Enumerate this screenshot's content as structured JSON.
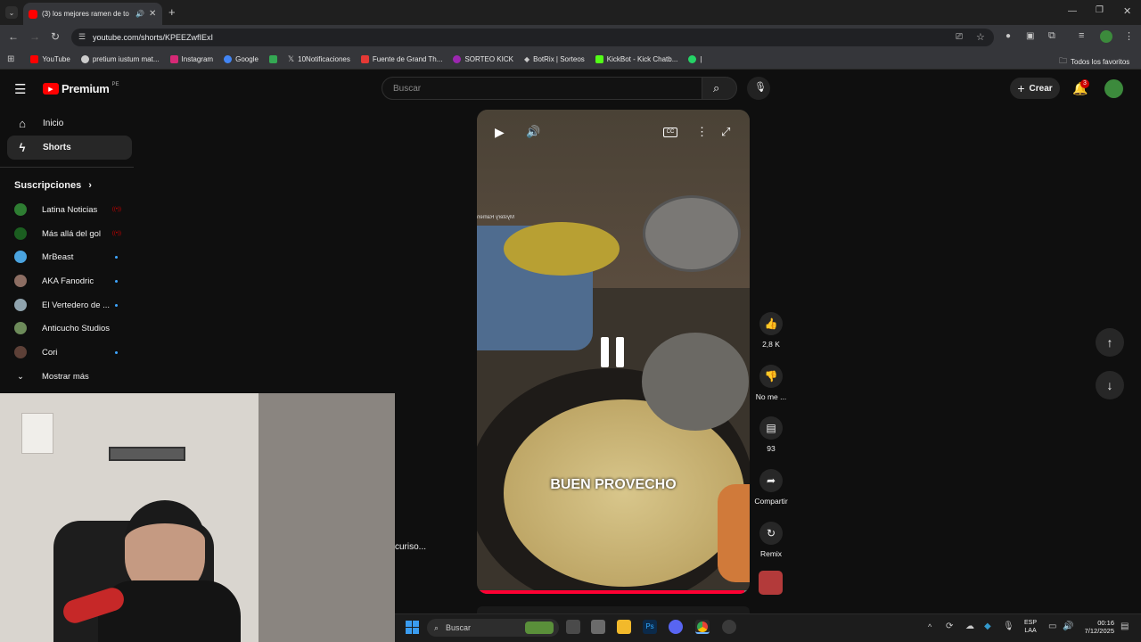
{
  "browser": {
    "tab_title": "(3) los mejores ramen de to",
    "url": "youtube.com/shorts/KPEEZwfIExI",
    "bookmarks": [
      {
        "label": "YouTube",
        "color": "#ff0000"
      },
      {
        "label": "pretium iustum mat...",
        "color": "#cccccc"
      },
      {
        "label": "Instagram",
        "color": "#d62976"
      },
      {
        "label": "Google",
        "color": "#4285f4"
      },
      {
        "label": "",
        "color": "#34a853"
      },
      {
        "label": "10Notificaciones",
        "color": "#e8e8e8"
      },
      {
        "label": "Fuente de Grand Th...",
        "color": "#e53935"
      },
      {
        "label": "SORTEO KICK",
        "color": "#9c27b0"
      },
      {
        "label": "BotRix | Sorteos",
        "color": "#e8e8e8"
      },
      {
        "label": "KickBot - Kick Chatb...",
        "color": "#53fc18"
      },
      {
        "label": "|",
        "color": "#25d366"
      }
    ],
    "all_bookmarks": "Todos los favoritos"
  },
  "youtube": {
    "logo_text": "Premium",
    "region": "PE",
    "search_placeholder": "Buscar",
    "create_label": "Crear",
    "notif_count": "3",
    "nav": [
      {
        "label": "Inicio",
        "icon": "home-icon"
      },
      {
        "label": "Shorts",
        "icon": "shorts-icon"
      }
    ],
    "subs_title": "Suscripciones",
    "subs": [
      {
        "label": "Latina Noticias",
        "color": "#2e7d32",
        "status": "live"
      },
      {
        "label": "Más allá del gol",
        "color": "#1b5e20",
        "status": "live"
      },
      {
        "label": "MrBeast",
        "color": "#4aa3df",
        "status": "dot"
      },
      {
        "label": "AKA Fanodric",
        "color": "#8d6e63",
        "status": "dot"
      },
      {
        "label": "El Vertedero de ...",
        "color": "#90a4ae",
        "status": "dot"
      },
      {
        "label": "Anticucho Studios",
        "color": "#6d8b5a",
        "status": "none"
      },
      {
        "label": "Cori",
        "color": "#5d4037",
        "status": "dot"
      }
    ],
    "show_more": "Mostrar más",
    "video_caption": "BUEN PROVECHO",
    "watermark": "Mystery Ramen",
    "partial_text": "curiso...",
    "actions": {
      "likes": "2,8 K",
      "dislike": "No me ...",
      "comments": "93",
      "share": "Compartir",
      "remix": "Remix"
    }
  },
  "taskbar": {
    "search": "Buscar",
    "lang_top": "ESP",
    "lang_bottom": "LAA",
    "time": "00:16",
    "date": "7/12/2025"
  }
}
